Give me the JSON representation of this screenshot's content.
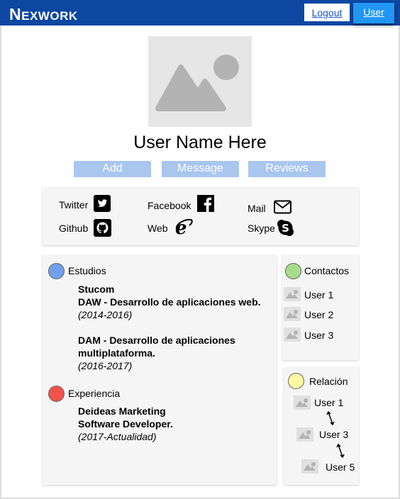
{
  "header": {
    "logo_first": "N",
    "logo_rest": "EXWORK",
    "logout_label": "Logout",
    "user_label": "User"
  },
  "profile": {
    "name": "User Name Here",
    "actions": [
      "Add",
      "Message",
      "Reviews"
    ]
  },
  "social": [
    {
      "label": "Twitter",
      "icon": "twitter-icon"
    },
    {
      "label": "Facebook",
      "icon": "facebook-icon"
    },
    {
      "label": "Mail",
      "icon": "mail-icon"
    },
    {
      "label": "Github",
      "icon": "github-icon"
    },
    {
      "label": "Web",
      "icon": "web-icon"
    },
    {
      "label": "Skype",
      "icon": "skype-icon"
    }
  ],
  "studies": {
    "title": "Estudios",
    "dot_color": "#6fa0ee",
    "entries": [
      {
        "lines": [
          "Stucom",
          "DAW - Desarrollo de aplicaciones web."
        ],
        "period": "(2014-2016)"
      },
      {
        "lines": [
          "DAM - Desarrollo de aplicaciones",
          "multiplataforma."
        ],
        "period": "(2016-2017)"
      }
    ]
  },
  "experience": {
    "title": "Experiencia",
    "dot_color": "#f2524b",
    "entries": [
      {
        "lines": [
          "Deideas Marketing",
          "Software Developer."
        ],
        "period": "(2017-Actualidad)"
      }
    ]
  },
  "contacts": {
    "title": "Contactos",
    "dot_color": "#a6dc8b",
    "items": [
      "User 1",
      "User 2",
      "User 3"
    ]
  },
  "relation": {
    "title": "Relación",
    "dot_color": "#fff9a1",
    "items": [
      "User 1",
      "User 3",
      "User 5"
    ]
  }
}
